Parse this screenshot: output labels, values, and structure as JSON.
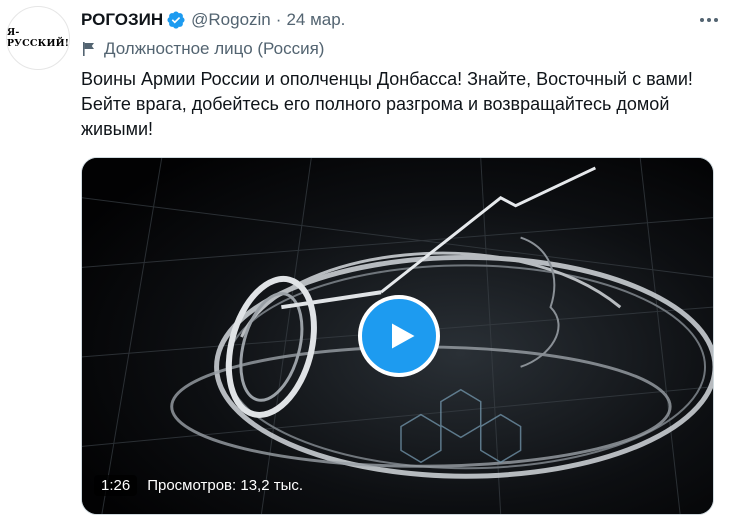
{
  "avatar": {
    "text": "Я-РУССКИЙ!"
  },
  "author": {
    "display_name": "РОГОЗИН",
    "handle": "@Rogozin",
    "separator": "·",
    "date": "24 мар.",
    "verified_icon": "verified-badge-icon"
  },
  "affiliation": {
    "icon": "flag-icon",
    "label": "Должностное лицо (Россия)"
  },
  "tweet": {
    "text": "Воины Армии России и ополченцы Донбасса! Знайте, Восточный с вами! Бейте врага, добейтесь его полного разгрома и возвращайтесь домой живыми!"
  },
  "media": {
    "type": "video",
    "play_icon": "play-icon",
    "duration": "1:26",
    "views": "Просмотров: 13,2 тыс."
  },
  "colors": {
    "accent": "#1d9bf0",
    "text_primary": "#0f1419",
    "text_secondary": "#536471"
  },
  "more_icon": "more-options-icon"
}
